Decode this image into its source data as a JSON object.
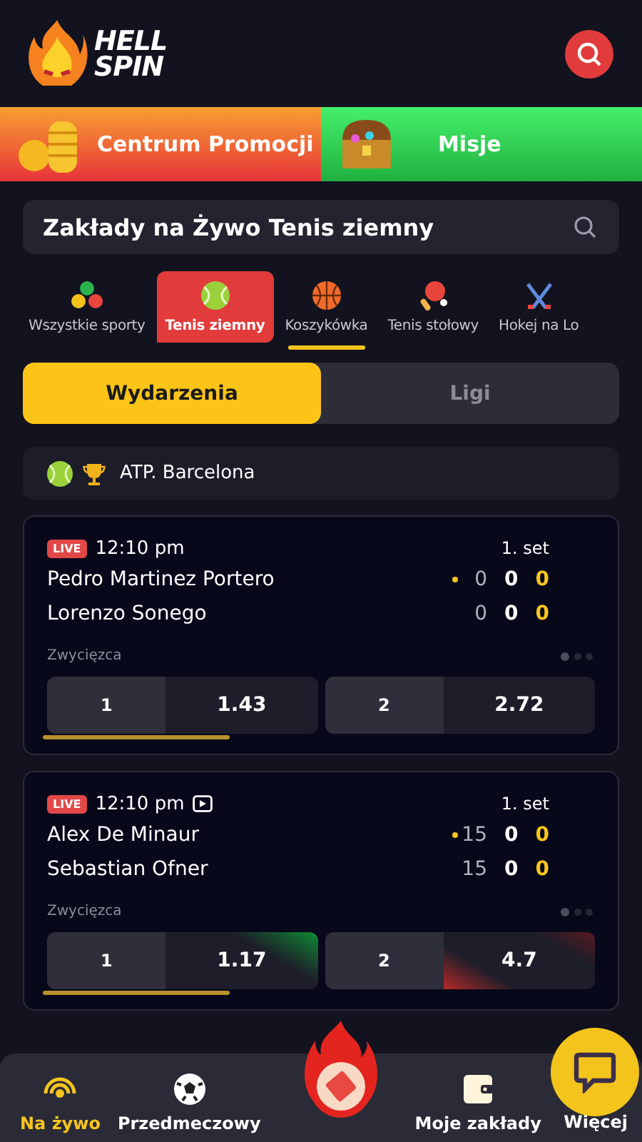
{
  "header": {
    "logo_lines": [
      "HELL",
      "SPIN"
    ]
  },
  "promos": [
    {
      "label": "Centrum Promocji",
      "kind": "coins"
    },
    {
      "label": "Misje",
      "kind": "chest"
    }
  ],
  "search": {
    "value": "Zakłady na Żywo Tenis ziemny"
  },
  "sports": [
    {
      "label": "Wszystkie sporty",
      "kind": "all",
      "selected": false,
      "underlined": false
    },
    {
      "label": "Tenis ziemny",
      "kind": "tennis",
      "selected": true,
      "underlined": false
    },
    {
      "label": "Koszykówka",
      "kind": "basketball",
      "selected": false,
      "underlined": true
    },
    {
      "label": "Tenis stołowy",
      "kind": "pingpong",
      "selected": false,
      "underlined": false
    },
    {
      "label": "Hokej na Lo",
      "kind": "hockey",
      "selected": false,
      "underlined": false
    }
  ],
  "view_toggle": [
    {
      "label": "Wydarzenia",
      "selected": true
    },
    {
      "label": "Ligi",
      "selected": false
    }
  ],
  "league": {
    "name": "ATP. Barcelona"
  },
  "matches": [
    {
      "live": "LIVE",
      "time": "12:10 pm",
      "stream": false,
      "period": "1. set",
      "players": [
        {
          "name": "Pedro Martinez Portero",
          "serving": true,
          "points": "0",
          "games": "0",
          "sets": "0"
        },
        {
          "name": "Lorenzo Sonego",
          "serving": false,
          "points": "0",
          "games": "0",
          "sets": "0"
        }
      ],
      "market": "Zwycięzca",
      "level": 0.68,
      "odds": [
        {
          "label": "1",
          "price": "1.43",
          "kind": "plain"
        },
        {
          "label": "2",
          "price": "2.72",
          "kind": "plain"
        }
      ]
    },
    {
      "live": "LIVE",
      "time": "12:10 pm",
      "stream": true,
      "period": "1. set",
      "players": [
        {
          "name": "Alex De Minaur",
          "serving": true,
          "points": "15",
          "games": "0",
          "sets": "0"
        },
        {
          "name": "Sebastian Ofner",
          "serving": false,
          "points": "15",
          "games": "0",
          "sets": "0"
        }
      ],
      "market": "Zwycięzca",
      "level": 0.68,
      "odds": [
        {
          "label": "1",
          "price": "1.17",
          "kind": "rising"
        },
        {
          "label": "2",
          "price": "4.7",
          "kind": "falling"
        }
      ]
    }
  ],
  "bottom_nav": [
    {
      "label": "Na żywo",
      "kind": "live",
      "selected": true
    },
    {
      "label": "Przedmeczowy",
      "kind": "ball",
      "selected": false
    },
    {
      "kind": "betslip"
    },
    {
      "label": "Moje zakłady",
      "kind": "wallet",
      "selected": false
    },
    {
      "label": "Więcej",
      "kind": "more",
      "selected": false
    }
  ]
}
